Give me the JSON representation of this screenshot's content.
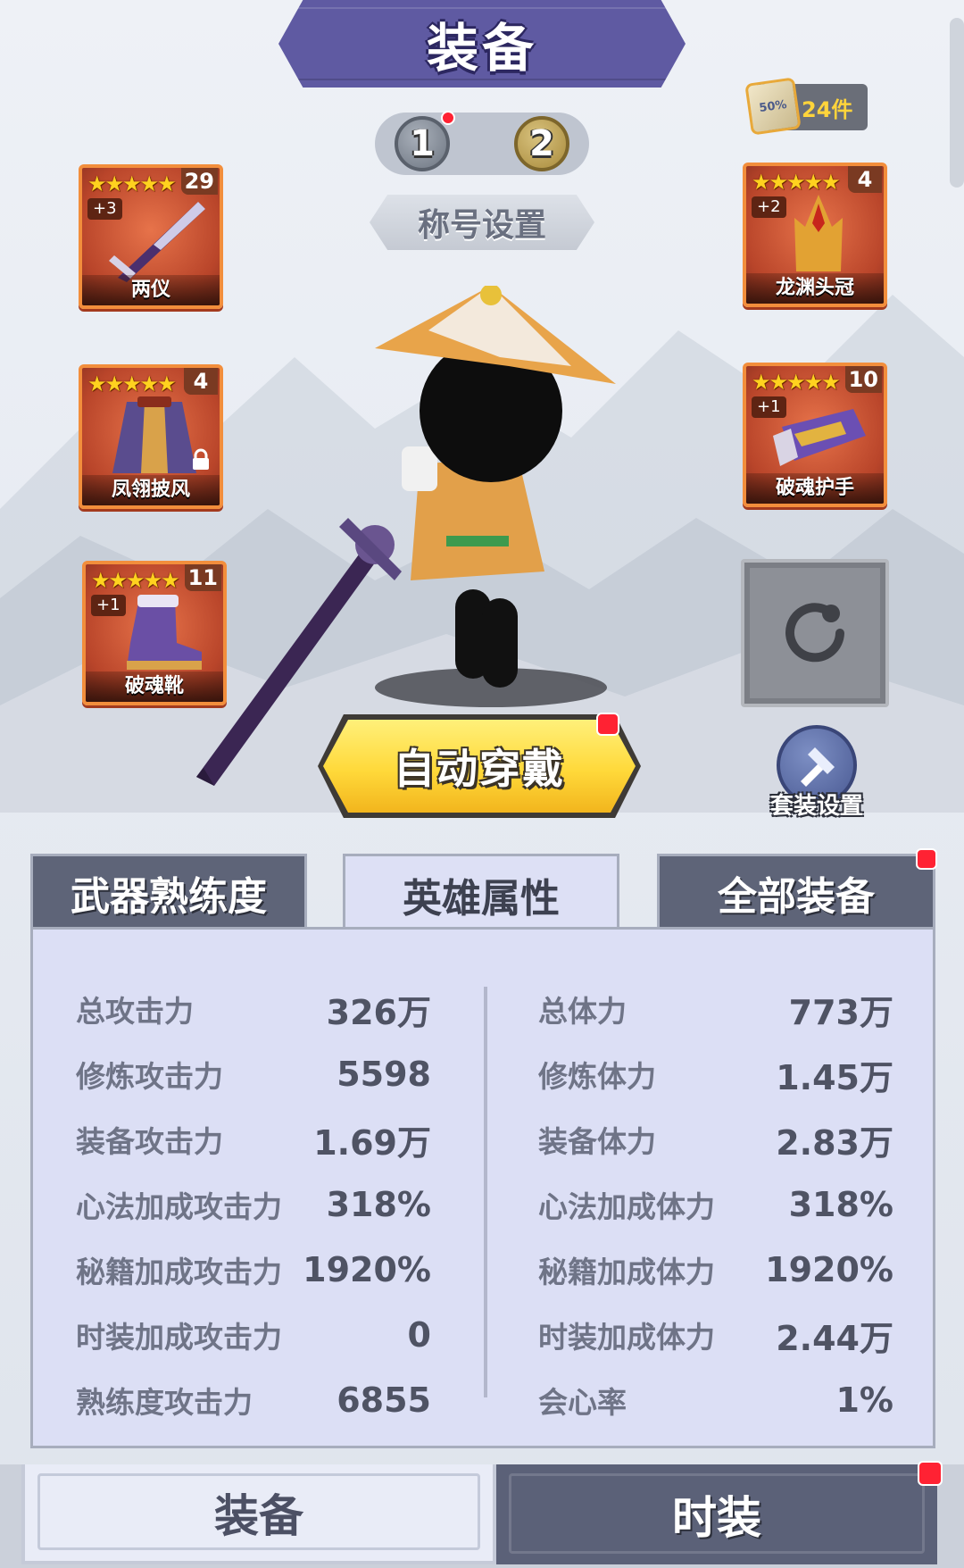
{
  "header": {
    "title": "装备"
  },
  "page_toggle": {
    "pages": [
      "1",
      "2"
    ],
    "selected": "2"
  },
  "title_setting": {
    "label": "称号设置"
  },
  "scroll_item": {
    "badge": "50%",
    "count": "24件"
  },
  "equipment": {
    "weapon": {
      "name": "两仪",
      "stars": "★★★★★",
      "count": "29",
      "plus": "+3"
    },
    "cloak": {
      "name": "凤翎披风",
      "stars": "★★★★★",
      "count": "4",
      "plus": ""
    },
    "boots": {
      "name": "破魂靴",
      "stars": "★★★★★",
      "count": "11",
      "plus": "+1"
    },
    "helmet": {
      "name": "龙渊头冠",
      "stars": "★★★★★",
      "count": "4",
      "plus": "+2"
    },
    "gloves": {
      "name": "破魂护手",
      "stars": "★★★★★",
      "count": "10",
      "plus": "+1"
    }
  },
  "auto_equip": {
    "label": "自动穿戴"
  },
  "set_setting": {
    "label": "套装设置"
  },
  "tabs": [
    {
      "label": "武器熟练度",
      "active": false
    },
    {
      "label": "英雄属性",
      "active": true
    },
    {
      "label": "全部装备",
      "active": false
    }
  ],
  "stats": {
    "left": [
      {
        "label": "总攻击力",
        "value": "326万"
      },
      {
        "label": "修炼攻击力",
        "value": "5598"
      },
      {
        "label": "装备攻击力",
        "value": "1.69万"
      },
      {
        "label": "心法加成攻击力",
        "value": "318%"
      },
      {
        "label": "秘籍加成攻击力",
        "value": "1920%"
      },
      {
        "label": "时装加成攻击力",
        "value": "0"
      },
      {
        "label": "熟练度攻击力",
        "value": "6855"
      }
    ],
    "right": [
      {
        "label": "总体力",
        "value": "773万"
      },
      {
        "label": "修炼体力",
        "value": "1.45万"
      },
      {
        "label": "装备体力",
        "value": "2.83万"
      },
      {
        "label": "心法加成体力",
        "value": "318%"
      },
      {
        "label": "秘籍加成体力",
        "value": "1920%"
      },
      {
        "label": "时装加成体力",
        "value": "2.44万"
      },
      {
        "label": "会心率",
        "value": "1%"
      }
    ]
  },
  "bottom_nav": [
    {
      "label": "装备",
      "active": true
    },
    {
      "label": "时装",
      "active": false
    }
  ],
  "colors": {
    "banner": "#5f5aa2",
    "card_orange": "#f28e3c",
    "auto_equip_yellow": "#ffd93a",
    "notification_red": "#ff2233",
    "panel": "#dcdff5"
  }
}
